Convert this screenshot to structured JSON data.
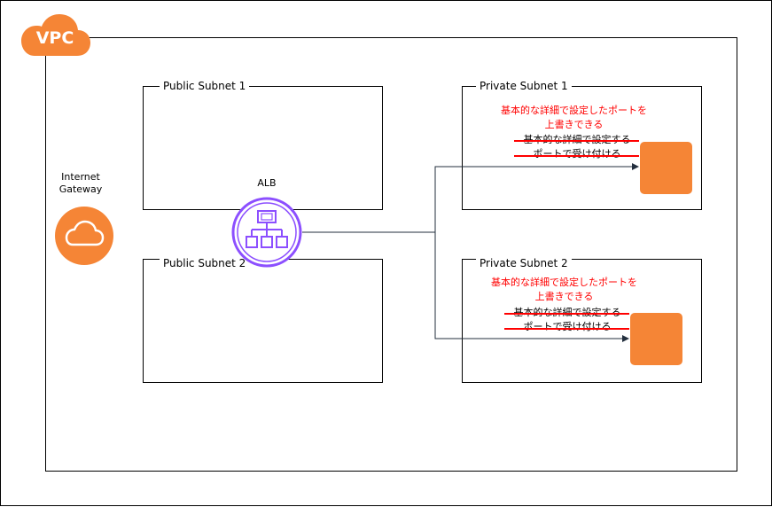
{
  "vpc": {
    "label": "VPC"
  },
  "internet_gateway": {
    "label": "Internet Gateway"
  },
  "alb": {
    "label": "ALB"
  },
  "subnets": {
    "public_1": {
      "label": "Public Subnet 1"
    },
    "public_2": {
      "label": "Public Subnet 2"
    },
    "private_1": {
      "label": "Private Subnet 1",
      "red_note": "基本的な詳細で設定したポートを上書きできる",
      "struck_note_line1": "基本的な詳細で設定する",
      "struck_note_line2": "ポートで受け付ける"
    },
    "private_2": {
      "label": "Private Subnet 2",
      "red_note": "基本的な詳細で設定したポートを上書きできる",
      "struck_note_line1": "基本的な詳細で設定する",
      "struck_note_line2": "ポートで受け付ける"
    }
  },
  "colors": {
    "aws_orange": "#f58536",
    "alb_purple": "#8c4fff",
    "note_red": "#ff0000",
    "arrow_navy": "#232f3e"
  }
}
